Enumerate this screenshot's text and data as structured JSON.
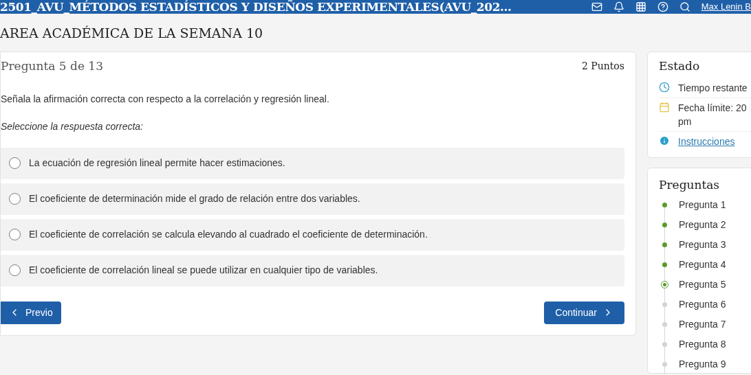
{
  "top_bar": {
    "course_title": "2501_AVU_MÉTODOS ESTADÍSTICOS Y DISEÑOS EXPERIMENTALES(AVU_202...",
    "user_name": "Max Lenin B"
  },
  "page_title": "AREA ACADÉMICA DE LA SEMANA 10",
  "question": {
    "counter": "Pregunta 5 de 13",
    "points": "2 Puntos",
    "prompt": "Señala la afirmación correcta con respecto a la correlación y regresión lineal.",
    "instruction": "Seleccione la respuesta correcta:",
    "options": [
      {
        "text": "La ecuación de regresión lineal permite hacer estimaciones.",
        "selected": false
      },
      {
        "text": "El coeficiente de determinación mide el grado de relación entre dos variables.",
        "selected": false
      },
      {
        "text": "El coeficiente de correlación se calcula elevando al cuadrado el coeficiente de determinación.",
        "selected": false
      },
      {
        "text": "El coeficiente de correlación lineal se puede utilizar en cualquier tipo de variables.",
        "selected": false
      }
    ],
    "prev_button": "Previo",
    "next_button": "Continuar"
  },
  "status_panel": {
    "title": "Estado",
    "items": [
      {
        "kind": "clock",
        "text": "Tiempo restante"
      },
      {
        "kind": "calendar",
        "text": "Fecha límite: 20 pm"
      },
      {
        "kind": "info",
        "text": "Instrucciones"
      }
    ]
  },
  "questions_panel": {
    "title": "Preguntas",
    "items": [
      {
        "label": "Pregunta 1",
        "answered": true,
        "current": false
      },
      {
        "label": "Pregunta 2",
        "answered": true,
        "current": false
      },
      {
        "label": "Pregunta 3",
        "answered": true,
        "current": false
      },
      {
        "label": "Pregunta 4",
        "answered": true,
        "current": false
      },
      {
        "label": "Pregunta 5",
        "answered": false,
        "current": true
      },
      {
        "label": "Pregunta 6",
        "answered": false,
        "current": false
      },
      {
        "label": "Pregunta 7",
        "answered": false,
        "current": false
      },
      {
        "label": "Pregunta 8",
        "answered": false,
        "current": false
      },
      {
        "label": "Pregunta 9",
        "answered": false,
        "current": false
      }
    ]
  }
}
